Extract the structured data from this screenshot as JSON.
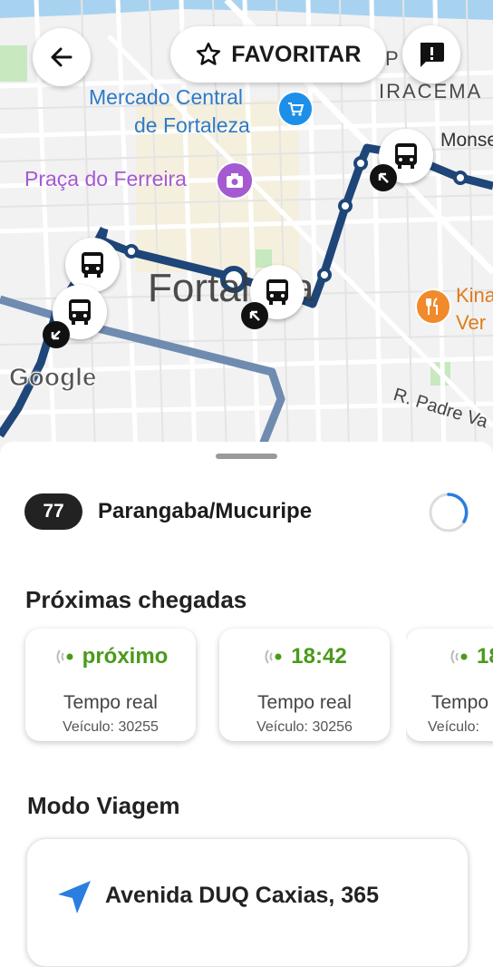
{
  "map": {
    "labels": {
      "market": "Mercado Central\nde Fortaleza",
      "market_line1": "Mercado Central",
      "market_line2": "de Fortaleza",
      "praca": "Praça do Ferreira",
      "city": "Fortaleza",
      "iracema_top": "P DE",
      "iracema": "IRACEMA",
      "monse": "Monse",
      "kina": "Kina",
      "ver": "Ver",
      "street": "R. Padre Va",
      "google": "Google"
    },
    "colors": {
      "route": "#1e4679",
      "route_light": "#6f8bb0",
      "market_pin": "#1d8fe8",
      "praca_pin": "#a45ad1",
      "food_pin": "#f08a2a",
      "water": "#a8d3f0",
      "park": "#c8e8c0"
    }
  },
  "header": {
    "back_icon": "arrow-left-icon",
    "favorite_label": "FAVORITAR",
    "favorite_icon": "star-outline-icon",
    "report_icon": "alert-message-icon"
  },
  "route": {
    "number": "77",
    "name": "Parangaba/Mucuripe",
    "refresh_icon": "loading-spinner-icon"
  },
  "arrivals": {
    "title": "Próximas chegadas",
    "cards": [
      {
        "time": "próximo",
        "kind": "Tempo real",
        "vehicle": "Veículo: 30255"
      },
      {
        "time": "18:42",
        "kind": "Tempo real",
        "vehicle": "Veículo: 30256"
      },
      {
        "time": "18",
        "kind": "Tempo",
        "vehicle": "Veículo:"
      }
    ],
    "live_color": "#4a9a1a"
  },
  "trip": {
    "title": "Modo Viagem",
    "address": "Avenida DUQ Caxias, 365",
    "icon": "navigation-arrow-icon"
  }
}
